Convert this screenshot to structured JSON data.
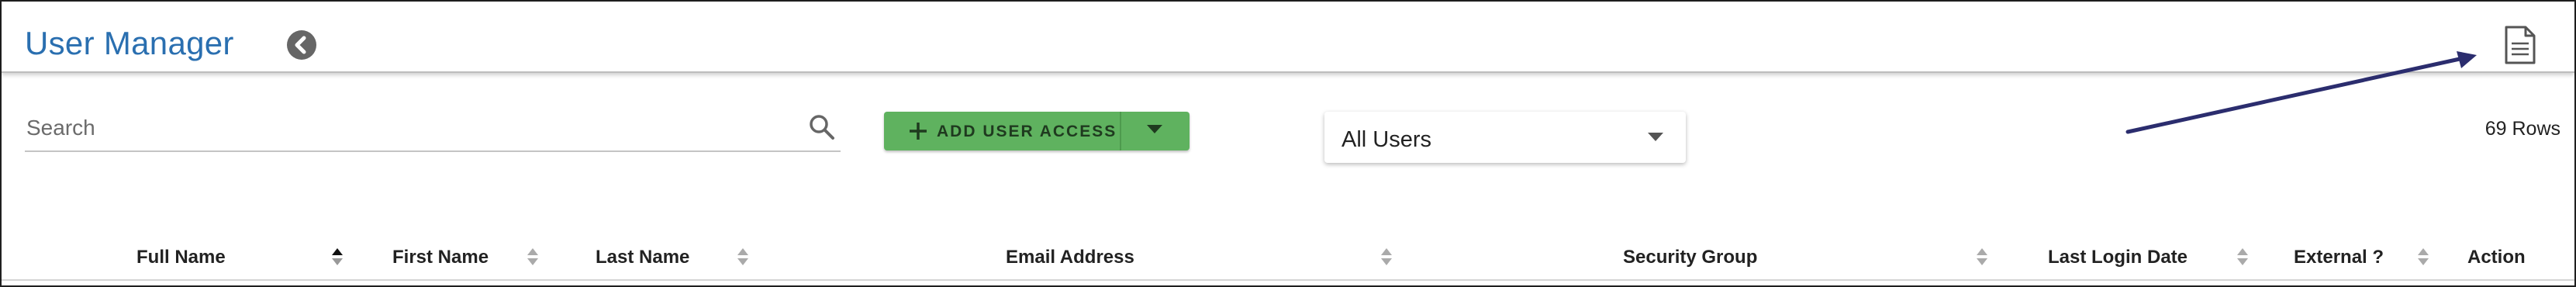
{
  "header": {
    "title": "User Manager"
  },
  "toolbar": {
    "search_placeholder": "Search",
    "add_user_access_label": "ADD USER ACCESS",
    "user_filter_value": "All Users",
    "row_count": "69 Rows"
  },
  "table": {
    "columns": [
      {
        "label": "Full Name",
        "sort": "ascending"
      },
      {
        "label": "First Name",
        "sort": "none"
      },
      {
        "label": "Last Name",
        "sort": "none"
      },
      {
        "label": "Email Address",
        "sort": "none"
      },
      {
        "label": "Security Group",
        "sort": "none"
      },
      {
        "label": "Last Login Date",
        "sort": "none"
      },
      {
        "label": "External ?",
        "sort": "none"
      },
      {
        "label": "Action",
        "sort": "none"
      }
    ]
  },
  "colors": {
    "title": "#2a6fb0",
    "add_button": "#5fb25f",
    "annotation_arrow": "#2b2d6e"
  },
  "icons": {
    "back": "chevron-left-circle-icon",
    "export": "document-icon",
    "search": "search-icon",
    "add": "plus-icon",
    "dropdown": "caret-down-icon"
  }
}
